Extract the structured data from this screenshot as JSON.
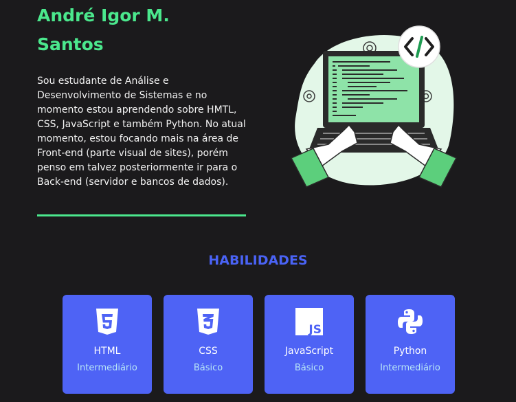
{
  "profile": {
    "name": "André Igor M. Santos",
    "bio": "Sou estudante de Análise e Desenvolvimento de Sistemas e no momento estou aprendendo sobre HMTL, CSS, JavaScript e também Python. No atual momento, estou focando mais na área de Front-end (parte visual de sites), porém penso em talvez posteriormente ir para o Back-end (servidor e bancos de dados)."
  },
  "illustration": {
    "icon": "code-tag-icon",
    "badge_text": "</>"
  },
  "skills": {
    "title": "HABILIDADES",
    "items": [
      {
        "name": "HTML",
        "level": "Intermediário",
        "icon": "html5-icon"
      },
      {
        "name": "CSS",
        "level": "Básico",
        "icon": "css3-icon"
      },
      {
        "name": "JavaScript",
        "level": "Básico",
        "icon": "javascript-icon"
      },
      {
        "name": "Python",
        "level": "Intermediário",
        "icon": "python-icon"
      }
    ]
  },
  "colors": {
    "background": "#1b1a1c",
    "accent_green": "#4be88d",
    "accent_blue": "#4e63f5",
    "level_text": "#b9e8f6"
  }
}
